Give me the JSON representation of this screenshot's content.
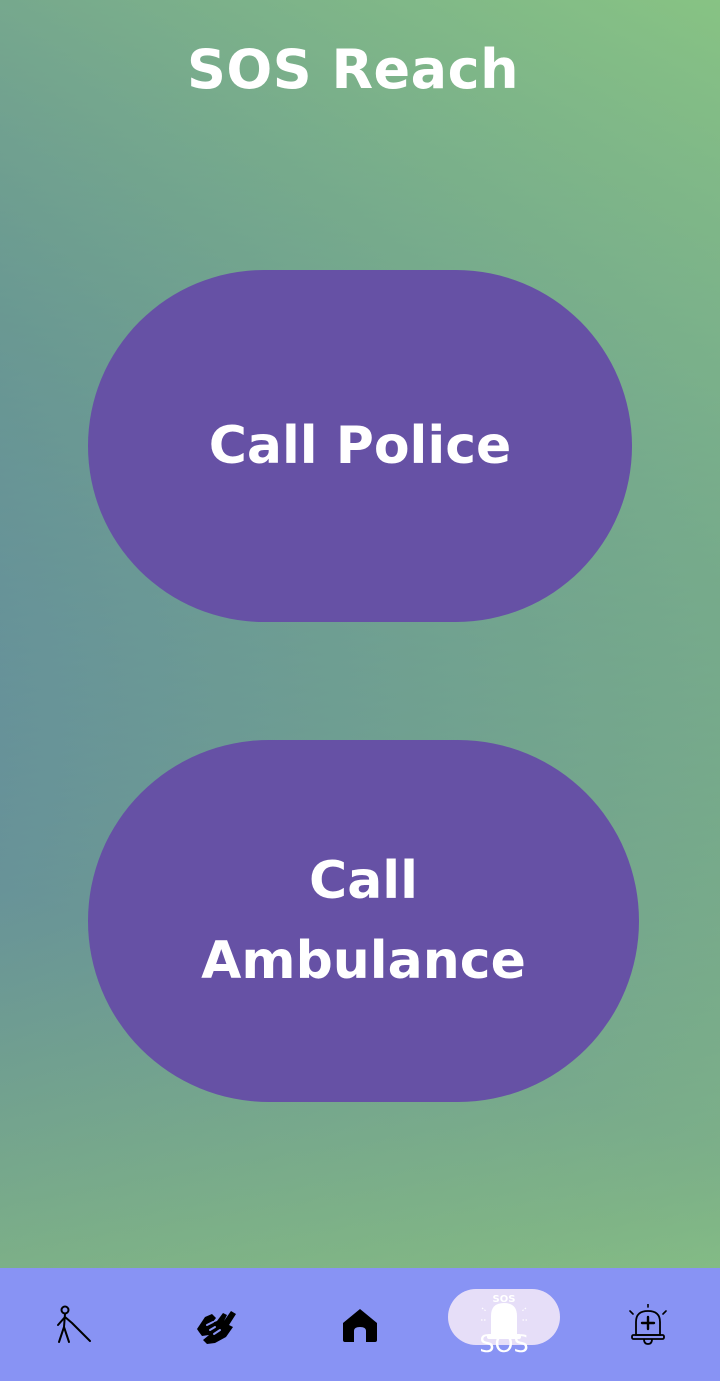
{
  "app": {
    "title": "SOS Reach"
  },
  "main": {
    "police_button": "Call Police",
    "ambulance_button_line1": "Call",
    "ambulance_button_line2": "Ambulance"
  },
  "bottom_nav": {
    "items": [
      {
        "icon": "blind-person-icon",
        "label": ""
      },
      {
        "icon": "sign-language-icon",
        "label": ""
      },
      {
        "icon": "home-icon",
        "label": ""
      },
      {
        "icon": "sos-siren-icon",
        "label": "SOS",
        "badge": "SOS",
        "active": true
      },
      {
        "icon": "medical-alarm-bell-icon",
        "label": ""
      }
    ]
  },
  "colors": {
    "button_fill": "#6651a5",
    "nav_background": "#8893f4",
    "active_pill": "#e6def8",
    "gradient_top": "#92d37d",
    "gradient_bottom": "#3f4fb3"
  }
}
